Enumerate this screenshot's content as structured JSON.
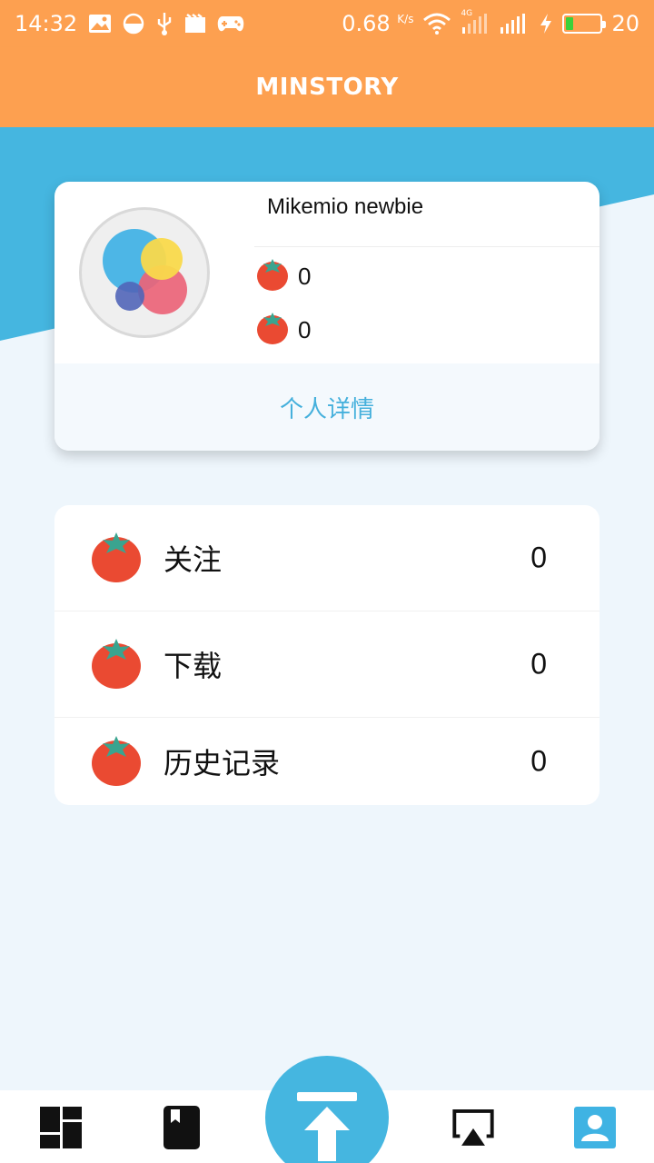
{
  "status_bar": {
    "time": "14:32",
    "speed": "0.68",
    "speed_unit": "K/s",
    "network_label": "4G",
    "battery": "20",
    "battery_level_percent": 20
  },
  "app_bar": {
    "title": "MINSTORY"
  },
  "profile": {
    "username": "Mikemio newbie",
    "stat_1": "0",
    "stat_2": "0",
    "details_label": "个人详情"
  },
  "menu": {
    "items": [
      {
        "label": "关注",
        "count": "0"
      },
      {
        "label": "下载",
        "count": "0"
      },
      {
        "label": "历史记录",
        "count": "0"
      }
    ]
  },
  "bottom_nav": {
    "items": [
      {
        "icon": "dashboard-icon",
        "active": false
      },
      {
        "icon": "bookmark-book-icon",
        "active": false
      },
      {
        "icon": "upload-icon",
        "active": false
      },
      {
        "icon": "airplay-icon",
        "active": false
      },
      {
        "icon": "profile-icon",
        "active": true
      }
    ]
  },
  "colors": {
    "header": "#fda050",
    "accent_blue": "#45b6e0",
    "page_bg": "#eef6fc",
    "details_text": "#45b0dc"
  }
}
